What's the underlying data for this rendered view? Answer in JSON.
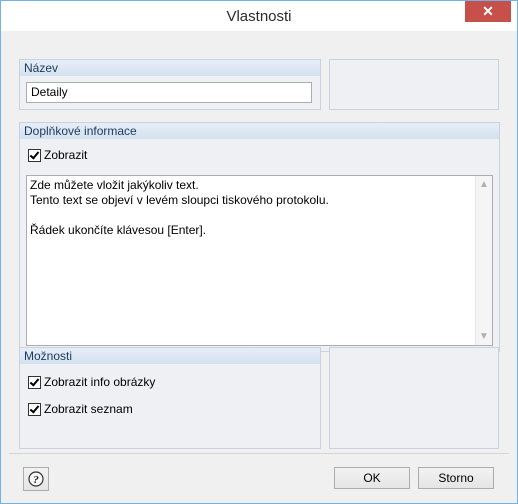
{
  "window": {
    "title": "Vlastnosti",
    "close_glyph": "✕"
  },
  "name_group": {
    "header": "Název",
    "value": "Detaily"
  },
  "info_group": {
    "header": "Doplňkové informace",
    "show_label": "Zobrazit",
    "show_checked": true,
    "memo_lines": [
      "Zde můžete vložit jakýkoliv text.",
      "Tento text se objeví v levém sloupci tiskového protokolu.",
      "",
      "Řádek ukončíte klávesou [Enter]."
    ]
  },
  "options_group": {
    "header": "Možnosti",
    "options": [
      {
        "label": "Zobrazit info obrázky",
        "checked": true
      },
      {
        "label": "Zobrazit seznam",
        "checked": true
      }
    ]
  },
  "footer": {
    "ok_label": "OK",
    "cancel_label": "Storno",
    "help_icon": "help-icon"
  }
}
